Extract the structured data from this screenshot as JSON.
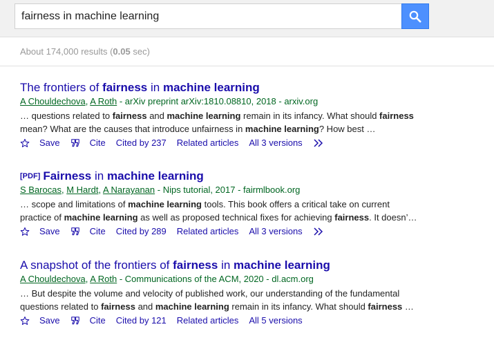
{
  "search": {
    "query": "fairness in machine learning"
  },
  "stats": {
    "prefix": "About 174,000 results (",
    "time": "0.05",
    "suffix": " sec)"
  },
  "results": [
    {
      "title": [
        {
          "t": "The frontiers of ",
          "b": false
        },
        {
          "t": "fairness",
          "b": true
        },
        {
          "t": " in ",
          "b": false
        },
        {
          "t": "machine learning",
          "b": true
        }
      ],
      "pdf": "",
      "authors": [
        "A Chouldechova",
        "A Roth"
      ],
      "source": " - arXiv preprint arXiv:1810.08810, 2018 - arxiv.org",
      "snippet": [
        {
          "t": "… questions related to ",
          "b": false
        },
        {
          "t": "fairness",
          "b": true
        },
        {
          "t": " and ",
          "b": false
        },
        {
          "t": "machine learning",
          "b": true
        },
        {
          "t": " remain in its infancy. What should ",
          "b": false
        },
        {
          "t": "fairness",
          "b": true
        },
        {
          "t": " mean? What are the causes that introduce unfairness in ",
          "b": false
        },
        {
          "t": "machine learning",
          "b": true
        },
        {
          "t": "? How best …",
          "b": false
        }
      ],
      "save": "Save",
      "cite": "Cite",
      "cited_by": "Cited by 237",
      "related": "Related articles",
      "versions": "All 3 versions",
      "has_more": true
    },
    {
      "title": [
        {
          "t": "Fairness",
          "b": true
        },
        {
          "t": " in ",
          "b": false
        },
        {
          "t": "machine learning",
          "b": true
        }
      ],
      "pdf": "[PDF]",
      "authors": [
        "S Barocas",
        "M Hardt",
        "A Narayanan"
      ],
      "source": " - Nips tutorial, 2017 - fairmlbook.org",
      "snippet": [
        {
          "t": "… scope and limitations of ",
          "b": false
        },
        {
          "t": "machine learning",
          "b": true
        },
        {
          "t": " tools. This book offers a critical take on current practice of ",
          "b": false
        },
        {
          "t": "machine learning",
          "b": true
        },
        {
          "t": " as well as proposed technical fixes for achieving ",
          "b": false
        },
        {
          "t": "fairness",
          "b": true
        },
        {
          "t": ". It doesn’…",
          "b": false
        }
      ],
      "save": "Save",
      "cite": "Cite",
      "cited_by": "Cited by 289",
      "related": "Related articles",
      "versions": "All 3 versions",
      "has_more": true
    },
    {
      "title": [
        {
          "t": "A snapshot of the frontiers of ",
          "b": false
        },
        {
          "t": "fairness",
          "b": true
        },
        {
          "t": " in ",
          "b": false
        },
        {
          "t": "machine learning",
          "b": true
        }
      ],
      "pdf": "",
      "authors": [
        "A Chouldechova",
        "A Roth"
      ],
      "source": " - Communications of the ACM, 2020 - dl.acm.org",
      "snippet": [
        {
          "t": "… But despite the volume and velocity of published work, our understanding of the fundamental questions related to ",
          "b": false
        },
        {
          "t": "fairness",
          "b": true
        },
        {
          "t": " and ",
          "b": false
        },
        {
          "t": "machine learning",
          "b": true
        },
        {
          "t": " remain in its infancy. What should ",
          "b": false
        },
        {
          "t": "fairness",
          "b": true
        },
        {
          "t": " …",
          "b": false
        }
      ],
      "save": "Save",
      "cite": "Cite",
      "cited_by": "Cited by 121",
      "related": "Related articles",
      "versions": "All 5 versions",
      "has_more": false
    }
  ],
  "colors": {
    "link": "#1a0dab",
    "author": "#006621",
    "search_button": "#4d90fe",
    "muted": "#999999"
  },
  "icons": {
    "search_button": "search-icon",
    "save": "star-icon",
    "cite": "quote-icon",
    "more": "double-chevron-icon"
  }
}
